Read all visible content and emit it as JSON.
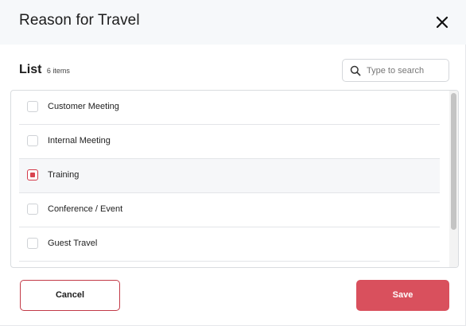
{
  "dialog": {
    "title": "Reason for Travel"
  },
  "list": {
    "title": "List",
    "count_label": "6 items",
    "search_placeholder": "Type to search",
    "items": [
      {
        "label": "Customer Meeting",
        "checked": false
      },
      {
        "label": "Internal Meeting",
        "checked": false
      },
      {
        "label": "Training",
        "checked": true
      },
      {
        "label": "Conference / Event",
        "checked": false
      },
      {
        "label": "Guest Travel",
        "checked": false
      },
      {
        "label": "",
        "checked": false
      }
    ]
  },
  "buttons": {
    "cancel_label": "Cancel",
    "save_label": "Save"
  },
  "colors": {
    "accent": "#d9505d",
    "accent_border": "#c23a47",
    "header_bg": "#f6f8fa"
  },
  "icons": {
    "close": "close-icon",
    "search": "search-icon",
    "checkbox": "checkbox-icon"
  }
}
